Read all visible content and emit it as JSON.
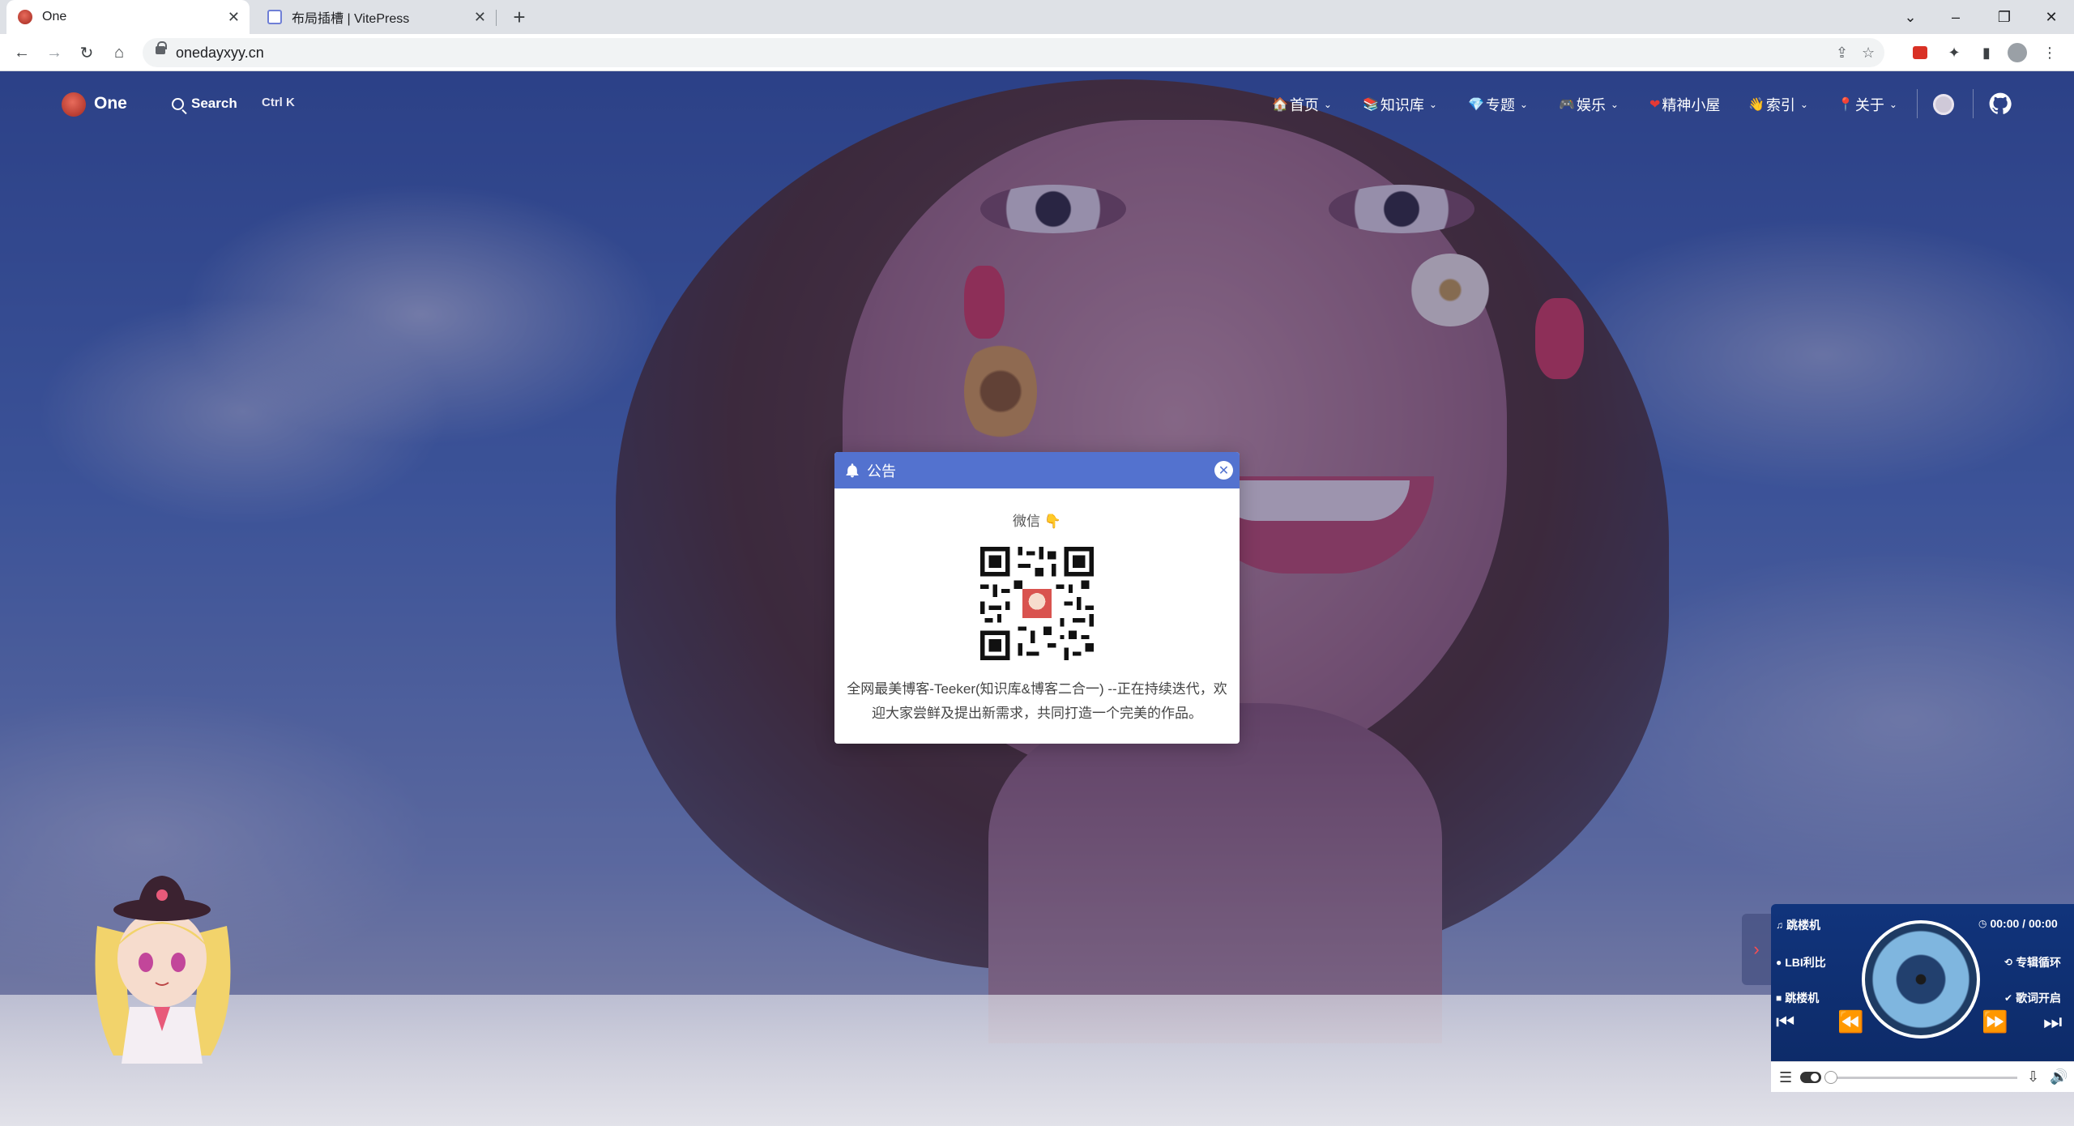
{
  "browser": {
    "tabs": [
      {
        "title": "One",
        "active": true
      },
      {
        "title": "布局插槽 | VitePress",
        "active": false
      }
    ],
    "new_tab": "+",
    "url": "onedayxyy.cn",
    "window_controls": {
      "tab_search": "⌄",
      "minimize": "–",
      "restore": "❐",
      "close": "✕"
    }
  },
  "site": {
    "logo_text": "One",
    "search_label": "Search",
    "search_shortcut": "Ctrl K",
    "nav": [
      {
        "emoji": "🏠",
        "label": "首页",
        "dropdown": true
      },
      {
        "emoji": "📚",
        "label": "知识库",
        "dropdown": true
      },
      {
        "emoji": "💎",
        "label": "专题",
        "dropdown": true
      },
      {
        "emoji": "🎮",
        "label": "娱乐",
        "dropdown": true
      },
      {
        "emoji": "❤",
        "label": "精神小屋",
        "dropdown": false
      },
      {
        "emoji": "👋",
        "label": "索引",
        "dropdown": true
      },
      {
        "emoji": "📍",
        "label": "关于",
        "dropdown": true
      }
    ]
  },
  "notice": {
    "title": "公告",
    "subtitle": "微信",
    "subtitle_icon": "👇",
    "body": "全网最美博客-Teeker(知识库&博客二合一) --正在持续迭代，欢迎大家尝鲜及提出新需求，共同打造一个完美的作品。"
  },
  "player": {
    "song": "跳楼机",
    "artist": "LBI利比",
    "album": "跳楼机",
    "time": "00:00 / 00:00",
    "loop_mode": "专辑循环",
    "lyrics": "歌词开启"
  },
  "colors": {
    "modal_header": "#5372cf",
    "player_bg": "#11347c",
    "overlay": "rgba(40,30,90,0.42)"
  }
}
